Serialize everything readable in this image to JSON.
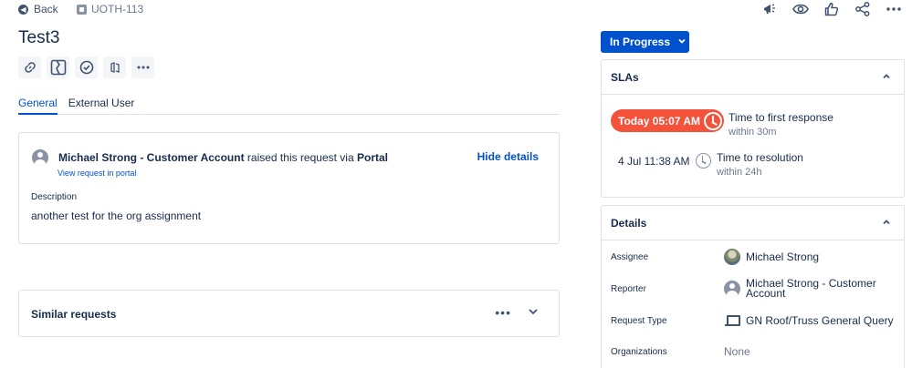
{
  "topbar": {
    "back_label": "Back",
    "issue_key": "UOTH-113",
    "icons": [
      "megaphone-icon",
      "eye-icon",
      "thumbs-up-icon",
      "share-icon",
      "more-icon"
    ]
  },
  "issue": {
    "title": "Test3",
    "action_icons": [
      "link-icon",
      "service-icon",
      "check-circle-icon",
      "automation-icon",
      "more-icon"
    ]
  },
  "tabs": [
    {
      "label": "General",
      "active": true
    },
    {
      "label": "External User",
      "active": false
    }
  ],
  "request": {
    "reporter": "Michael Strong - Customer Account",
    "raised_text": " raised this request via ",
    "channel": "Portal",
    "view_link": "View request in portal",
    "hide_details": "Hide details",
    "description_label": "Description",
    "description": "another test for the org assignment"
  },
  "similar": {
    "title": "Similar requests",
    "more": "•••"
  },
  "status": {
    "label": "In Progress",
    "color": "#0052cc"
  },
  "slas": {
    "title": "SLAs",
    "items": [
      {
        "time": "Today 05:07 AM",
        "name": "Time to first response",
        "target": "within 30m",
        "breached_color": "#f4523b"
      },
      {
        "time": "4 Jul 11:38 AM",
        "name": "Time to resolution",
        "target": "within 24h"
      }
    ]
  },
  "details": {
    "title": "Details",
    "rows": [
      {
        "label": "Assignee",
        "value": "Michael Strong",
        "icon": "user-photo-avatar"
      },
      {
        "label": "Reporter",
        "value": "Michael Strong - Customer Account",
        "icon": "default-avatar-icon"
      },
      {
        "label": "Request Type",
        "value": "GN Roof/Truss General Query",
        "icon": "laptop-icon"
      },
      {
        "label": "Organizations",
        "value": "None",
        "icon": ""
      }
    ]
  }
}
